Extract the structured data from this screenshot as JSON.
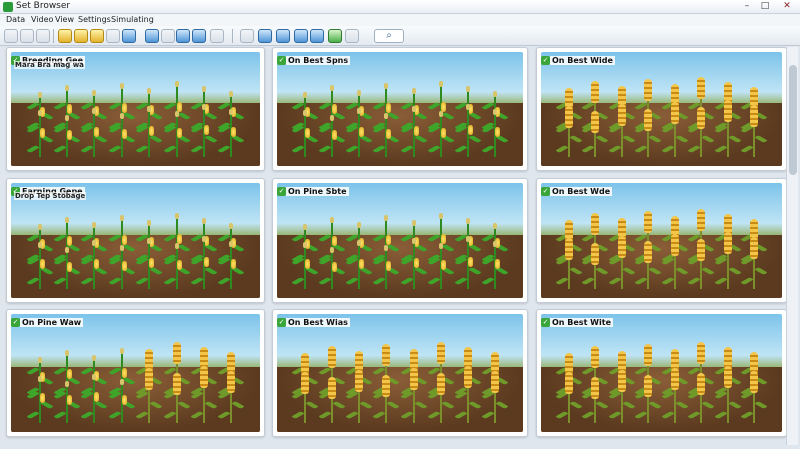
{
  "window": {
    "title": "Set Browser",
    "min": "–",
    "max": "□",
    "close": "✕"
  },
  "menu": [
    "Data",
    "Video",
    "View",
    "Settings",
    "Simulating"
  ],
  "toolbar": {
    "icons": [
      "zoom-icon",
      "rotate-icon",
      "select-icon",
      "seed-icon",
      "corn-icon",
      "dropdown-icon",
      "move-icon",
      "arrow-icon",
      "globe-icon",
      "dropdown-icon",
      "save-icon",
      "tile-icon",
      "arrow-icon",
      "pen-icon",
      "water-icon",
      "link-icon",
      "camera-icon",
      "plant-icon",
      "sun-icon",
      "layers-icon"
    ],
    "search_icon": "⌕"
  },
  "panels": [
    {
      "title": "Breeding Gee",
      "subtitle": "Mara Bra mag wa",
      "crop": "corn",
      "stage": "green"
    },
    {
      "title": "On Best Spns",
      "subtitle": "",
      "crop": "corn",
      "stage": "green"
    },
    {
      "title": "On Best Wide",
      "subtitle": "",
      "crop": "wheat",
      "stage": "ripe"
    },
    {
      "title": "Earning Gepe",
      "subtitle": "Drop Tep Stobage",
      "crop": "corn",
      "stage": "green"
    },
    {
      "title": "On Pine Sbte",
      "subtitle": "",
      "crop": "corn",
      "stage": "green"
    },
    {
      "title": "On Best Wde",
      "subtitle": "",
      "crop": "wheat",
      "stage": "ripe"
    },
    {
      "title": "On Pine Waw",
      "subtitle": "",
      "crop": "corn",
      "stage": "ripening"
    },
    {
      "title": "On Best Wias",
      "subtitle": "",
      "crop": "wheat",
      "stage": "mixed"
    },
    {
      "title": "On Best Wite",
      "subtitle": "",
      "crop": "wheat",
      "stage": "ripe"
    }
  ],
  "colors": {
    "accent": "#3aa63a",
    "sky": "#7cc3ea",
    "soil": "#5b3a1f",
    "corn": "#ffe76a",
    "wheat": "#f3c64a"
  }
}
